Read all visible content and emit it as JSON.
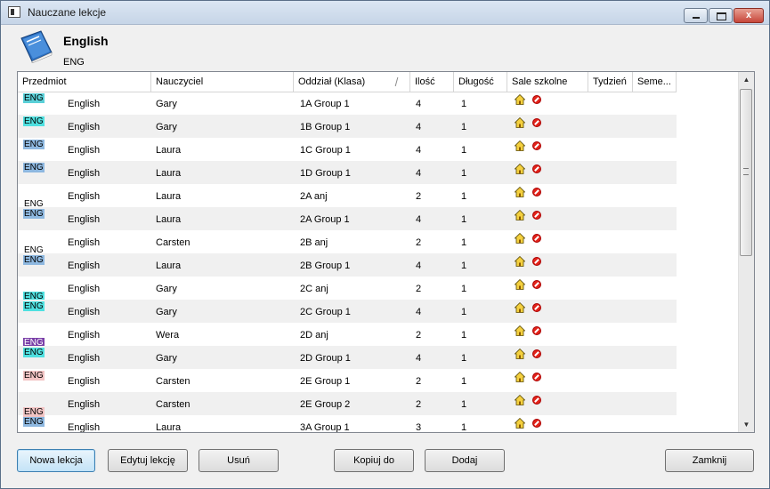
{
  "window": {
    "title": "Nauczane lekcje",
    "controls": {
      "minimize": "",
      "maximize": "",
      "close": "x"
    }
  },
  "subject": {
    "name": "English",
    "code": "ENG"
  },
  "columns": [
    "Przedmiot",
    "Nauczyciel",
    "Oddział (Klasa)",
    "Ilość",
    "Długość",
    "Sale szkolne",
    "Tydzień",
    "Seme..."
  ],
  "rows": [
    {
      "badge": "ENG",
      "badge_color": "#5ad0d8",
      "badge_pos": "up",
      "subject": "English",
      "teacher": "Gary",
      "class": "1A Group 1",
      "count": "4",
      "length": "1"
    },
    {
      "badge": "ENG",
      "badge_color": "#4fe0e0",
      "badge_pos": "up",
      "subject": "English",
      "teacher": "Gary",
      "class": "1B Group 1",
      "count": "4",
      "length": "1"
    },
    {
      "badge": "ENG",
      "badge_color": "#8eb8e0",
      "badge_pos": "up",
      "subject": "English",
      "teacher": "Laura",
      "class": "1C Group 1",
      "count": "4",
      "length": "1"
    },
    {
      "badge": "ENG",
      "badge_color": "#8eb8e0",
      "badge_pos": "up",
      "subject": "English",
      "teacher": "Laura",
      "class": "1D Group 1",
      "count": "4",
      "length": "1"
    },
    {
      "badge": "ENG",
      "badge_color": "#ffffff",
      "badge_pos": "down",
      "subject": "English",
      "teacher": "Laura",
      "class": "2A anj",
      "count": "2",
      "length": "1"
    },
    {
      "badge": "ENG",
      "badge_color": "#8eb8e0",
      "badge_pos": "up",
      "subject": "English",
      "teacher": "Laura",
      "class": "2A Group 1",
      "count": "4",
      "length": "1"
    },
    {
      "badge": "ENG",
      "badge_color": "#ffffff",
      "badge_pos": "down",
      "subject": "English",
      "teacher": "Carsten",
      "class": "2B anj",
      "count": "2",
      "length": "1"
    },
    {
      "badge": "ENG",
      "badge_color": "#8eb8e0",
      "badge_pos": "up",
      "subject": "English",
      "teacher": "Laura",
      "class": "2B Group 1",
      "count": "4",
      "length": "1"
    },
    {
      "badge": "ENG",
      "badge_color": "#4fe0e0",
      "badge_pos": "down",
      "subject": "English",
      "teacher": "Gary",
      "class": "2C anj",
      "count": "2",
      "length": "1"
    },
    {
      "badge": "ENG",
      "badge_color": "#4fe0e0",
      "badge_pos": "up",
      "subject": "English",
      "teacher": "Gary",
      "class": "2C Group 1",
      "count": "4",
      "length": "1"
    },
    {
      "badge": "ENG",
      "badge_color": "#7a3fa8",
      "badge_pos": "down",
      "subject": "English",
      "teacher": "Wera",
      "class": "2D anj",
      "count": "2",
      "length": "1"
    },
    {
      "badge": "ENG",
      "badge_color": "#4fe0e0",
      "badge_pos": "up",
      "subject": "English",
      "teacher": "Gary",
      "class": "2D Group 1",
      "count": "4",
      "length": "1"
    },
    {
      "badge": "ENG",
      "badge_color": "#f2c4c4",
      "badge_pos": "up",
      "subject": "English",
      "teacher": "Carsten",
      "class": "2E Group 1",
      "count": "2",
      "length": "1"
    },
    {
      "badge": "ENG",
      "badge_color": "#f2c4c4",
      "badge_pos": "down",
      "subject": "English",
      "teacher": "Carsten",
      "class": "2E Group 2",
      "count": "2",
      "length": "1"
    },
    {
      "badge": "ENG",
      "badge_color": "#8eb8e0",
      "badge_pos": "up",
      "subject": "English",
      "teacher": "Laura",
      "class": "3A Group 1",
      "count": "3",
      "length": "1"
    }
  ],
  "room_icons": [
    "house-icon",
    "prohibited-icon"
  ],
  "scrollbar": {
    "up_glyph": "▲",
    "down_glyph": "▼"
  },
  "buttons": {
    "new_lesson": "Nowa lekcja",
    "edit_lesson": "Edytuj lekcję",
    "delete": "Usuń",
    "copy_to": "Kopiuj do",
    "add": "Dodaj",
    "close": "Zamknij"
  }
}
